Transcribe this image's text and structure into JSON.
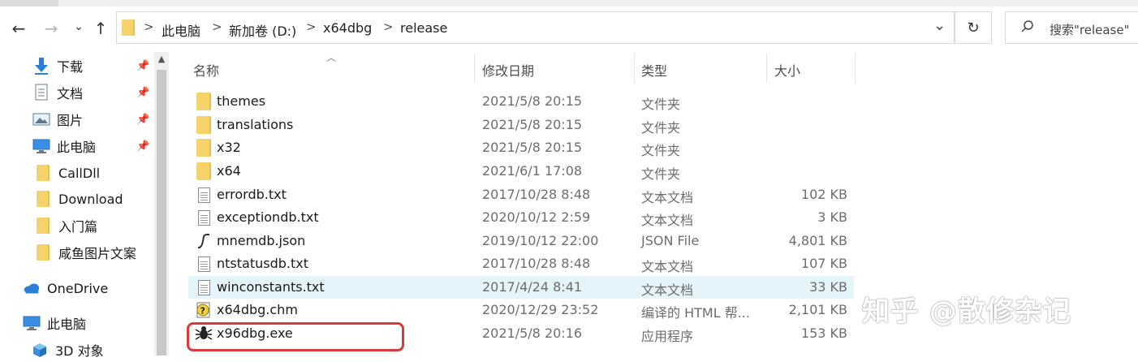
{
  "address_bar": {
    "path": [
      "此电脑",
      "新加卷 (D:)",
      "x64dbg",
      "release"
    ],
    "separator": ">"
  },
  "nav": {
    "back_glyph": "←",
    "forward_glyph": "→",
    "recent_glyph": "⌄",
    "up_glyph": "↑",
    "dropdown_glyph": "⌄",
    "refresh_glyph": "↻"
  },
  "search": {
    "placeholder": "搜索\"release\""
  },
  "sidebar": {
    "items": [
      {
        "label": "下载",
        "icon": "download-arrow-icon",
        "pinned": true
      },
      {
        "label": "文档",
        "icon": "document-icon",
        "pinned": true
      },
      {
        "label": "图片",
        "icon": "picture-icon",
        "pinned": true
      },
      {
        "label": "此电脑",
        "icon": "computer-icon",
        "pinned": true
      },
      {
        "label": "CallDll",
        "icon": "folder-icon",
        "pinned": false
      },
      {
        "label": "Download",
        "icon": "folder-icon",
        "pinned": false
      },
      {
        "label": "入门篇",
        "icon": "folder-icon",
        "pinned": false
      },
      {
        "label": "咸鱼图片文案",
        "icon": "folder-icon",
        "pinned": false
      },
      {
        "label": "OneDrive",
        "icon": "cloud-icon",
        "pinned": false
      },
      {
        "label": "此电脑",
        "icon": "computer-icon",
        "pinned": false
      },
      {
        "label": "3D 对象",
        "icon": "cube-3d-icon",
        "pinned": false
      }
    ]
  },
  "columns": {
    "name": "名称",
    "modified": "修改日期",
    "type": "类型",
    "size": "大小"
  },
  "files": [
    {
      "name": "themes",
      "date": "2021/5/8 20:15",
      "type": "文件夹",
      "size": "",
      "icon": "folder-icon"
    },
    {
      "name": "translations",
      "date": "2021/5/8 20:15",
      "type": "文件夹",
      "size": "",
      "icon": "folder-icon"
    },
    {
      "name": "x32",
      "date": "2021/5/8 20:15",
      "type": "文件夹",
      "size": "",
      "icon": "folder-icon"
    },
    {
      "name": "x64",
      "date": "2021/6/1 17:08",
      "type": "文件夹",
      "size": "",
      "icon": "folder-icon"
    },
    {
      "name": "errordb.txt",
      "date": "2017/10/28 8:48",
      "type": "文本文档",
      "size": "102 KB",
      "icon": "text-file-icon"
    },
    {
      "name": "exceptiondb.txt",
      "date": "2020/10/12 2:59",
      "type": "文本文档",
      "size": "3 KB",
      "icon": "text-file-icon"
    },
    {
      "name": "mnemdb.json",
      "date": "2019/10/12 22:00",
      "type": "JSON File",
      "size": "4,801 KB",
      "icon": "json-file-icon"
    },
    {
      "name": "ntstatusdb.txt",
      "date": "2017/10/28 8:48",
      "type": "文本文档",
      "size": "107 KB",
      "icon": "text-file-icon"
    },
    {
      "name": "winconstants.txt",
      "date": "2017/4/24 8:41",
      "type": "文本文档",
      "size": "33 KB",
      "icon": "text-file-icon"
    },
    {
      "name": "x64dbg.chm",
      "date": "2020/12/29 23:52",
      "type": "编译的 HTML 帮...",
      "size": "2,101 KB",
      "icon": "help-file-icon"
    },
    {
      "name": "x96dbg.exe",
      "date": "2021/5/8 20:16",
      "type": "应用程序",
      "size": "153 KB",
      "icon": "bug-exe-icon"
    }
  ],
  "watermark": "知乎 @散修杂记",
  "colors": {
    "highlight_row": "#e5f3fb",
    "annotation_box": "#d93a3a",
    "folder": "#f6d36a"
  }
}
